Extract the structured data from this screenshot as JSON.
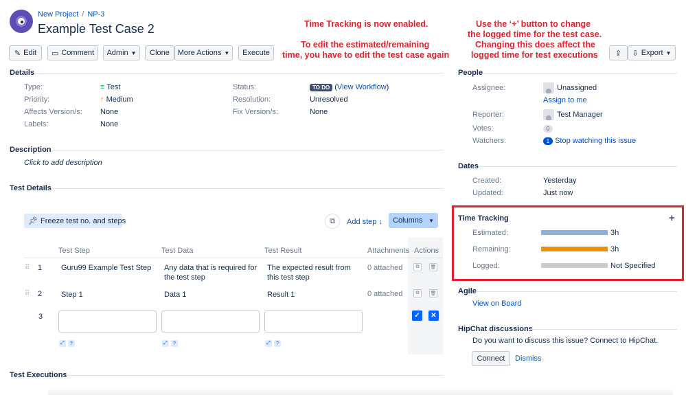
{
  "breadcrumb": {
    "project": "New Project",
    "sep": "/",
    "key": "NP-3"
  },
  "issue": {
    "title": "Example Test Case 2"
  },
  "annotations": {
    "left_line1": "Time Tracking is now enabled.",
    "left_line2": "To edit the estimated/remaining",
    "left_line3": "time, you have to edit the test case again",
    "right_line1": "Use the ‘+’ button to change",
    "right_line2": "the logged time for the test case.",
    "right_line3": "Changing this does affect the",
    "right_line4": "logged time for test executions"
  },
  "toolbar": {
    "edit": "Edit",
    "comment": "Comment",
    "admin": "Admin",
    "clone": "Clone",
    "more_actions": "More Actions",
    "execute": "Execute",
    "export": "Export"
  },
  "details": {
    "heading": "Details",
    "type_label": "Type:",
    "type_value": "Test",
    "priority_label": "Priority:",
    "priority_value": "Medium",
    "affects_label": "Affects Version/s:",
    "affects_value": "None",
    "labels_label": "Labels:",
    "labels_value": "None",
    "status_label": "Status:",
    "status_value": "TO DO",
    "status_workflow_open": "(",
    "status_workflow": "View Workflow",
    "status_workflow_close": ")",
    "resolution_label": "Resolution:",
    "resolution_value": "Unresolved",
    "fix_label": "Fix Version/s:",
    "fix_value": "None"
  },
  "description": {
    "heading": "Description",
    "placeholder": "Click to add description"
  },
  "test_details": {
    "heading": "Test Details",
    "freeze": "Freeze test no. and steps",
    "add_step": "Add step",
    "columns": "Columns",
    "headers": [
      "Test Step",
      "Test Data",
      "Test Result",
      "Attachments",
      "Actions"
    ],
    "rows": [
      {
        "num": "1",
        "step": "Guru99 Example Test Step",
        "data": "Any data that is required for the test step",
        "result": "The expected result from this test step",
        "attachments": "0 attached"
      },
      {
        "num": "2",
        "step": "Step 1",
        "data": "Data 1",
        "result": "Result 1",
        "attachments": "0 attached"
      }
    ],
    "new_row_num": "3"
  },
  "test_executions": {
    "heading": "Test Executions"
  },
  "people": {
    "heading": "People",
    "assignee_label": "Assignee:",
    "assignee_value": "Unassigned",
    "assign_to_me": "Assign to me",
    "reporter_label": "Reporter:",
    "reporter_value": "Test Manager",
    "votes_label": "Votes:",
    "votes_value": "0",
    "watchers_label": "Watchers:",
    "watchers_count": "1",
    "watchers_link": "Stop watching this issue"
  },
  "dates": {
    "heading": "Dates",
    "created_label": "Created:",
    "created_value": "Yesterday",
    "updated_label": "Updated:",
    "updated_value": "Just now"
  },
  "time_tracking": {
    "heading": "Time Tracking",
    "add": "+",
    "estimated_label": "Estimated:",
    "estimated_value": "3h",
    "estimated_color": "#8eb0d8",
    "estimated_fill": 1.0,
    "remaining_label": "Remaining:",
    "remaining_value": "3h",
    "remaining_color": "#e8900e",
    "remaining_fill": 1.0,
    "logged_label": "Logged:",
    "logged_value": "Not Specified",
    "logged_color": "#cccccc",
    "logged_fill": 1.0
  },
  "agile": {
    "heading": "Agile",
    "link": "View on Board"
  },
  "hipchat": {
    "heading": "HipChat discussions",
    "text": "Do you want to discuss this issue? Connect to HipChat.",
    "connect": "Connect",
    "dismiss": "Dismiss"
  },
  "colors": {
    "annotation_red": "#e5222b",
    "highlight_border": "#e5222b",
    "link_blue": "#0052cc"
  }
}
